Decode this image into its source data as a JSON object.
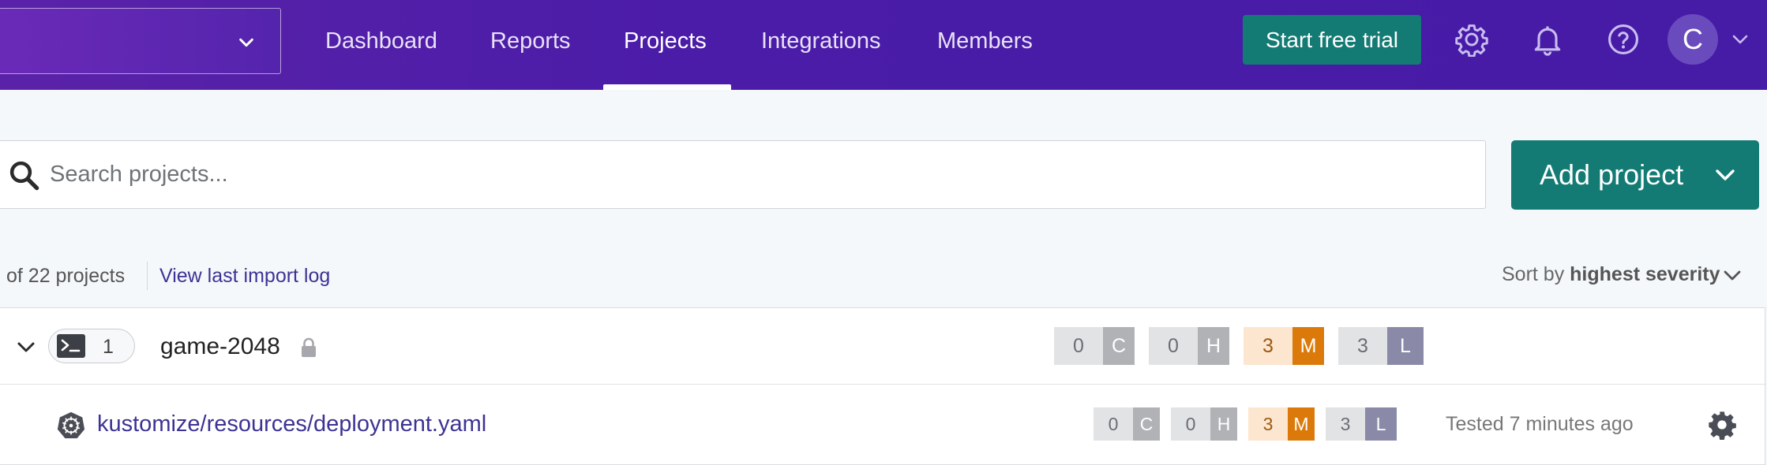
{
  "nav": {
    "items": [
      {
        "label": "Dashboard"
      },
      {
        "label": "Reports"
      },
      {
        "label": "Projects"
      },
      {
        "label": "Integrations"
      },
      {
        "label": "Members"
      }
    ],
    "active": "Projects",
    "trial_button": "Start free trial",
    "avatar_initial": "C",
    "icons": [
      "settings-gear-icon",
      "notification-bell-icon",
      "help-question-icon"
    ]
  },
  "search": {
    "placeholder": "Search projects...",
    "value": ""
  },
  "add_project": {
    "label": "Add project"
  },
  "summary": {
    "count_text": "of 22 projects",
    "import_log_link": "View last import log",
    "sort_prefix": "Sort by",
    "sort_value": "highest severity"
  },
  "project": {
    "name": "game-2048",
    "source_count": "1",
    "private": true,
    "severity": {
      "c": {
        "count": "0",
        "label": "C"
      },
      "h": {
        "count": "0",
        "label": "H"
      },
      "m": {
        "count": "3",
        "label": "M"
      },
      "l": {
        "count": "3",
        "label": "L"
      }
    },
    "targets": [
      {
        "file": "kustomize/resources/deployment.yaml",
        "tested": "Tested 7 minutes ago",
        "severity": {
          "c": {
            "count": "0",
            "label": "C"
          },
          "h": {
            "count": "0",
            "label": "H"
          },
          "m": {
            "count": "3",
            "label": "M"
          },
          "l": {
            "count": "3",
            "label": "L"
          }
        }
      }
    ]
  },
  "colors": {
    "nav_bg": "#4a1ca8",
    "primary_button": "#137b74",
    "link": "#3d3394",
    "medium": "#db7a0a",
    "low": "#8a8aa8"
  }
}
